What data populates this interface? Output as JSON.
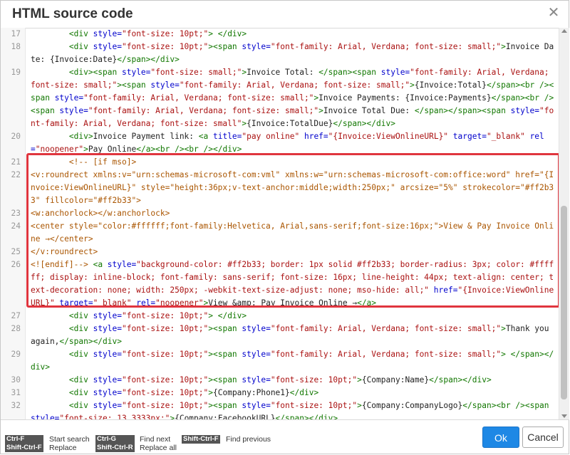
{
  "dialog": {
    "title": "HTML source code",
    "close_symbol": "✕",
    "ok_label": "Ok",
    "cancel_label": "Cancel"
  },
  "editor": {
    "lines": [
      {
        "num": "17",
        "tokens": [
          {
            "c": "x",
            "v": "        "
          },
          {
            "c": "t",
            "v": "<div "
          },
          {
            "c": "a",
            "v": "style="
          },
          {
            "c": "s",
            "v": "\"font-size: 10pt;\""
          },
          {
            "c": "t",
            "v": "> </div>"
          }
        ]
      },
      {
        "num": "18",
        "tokens": [
          {
            "c": "x",
            "v": "        "
          },
          {
            "c": "t",
            "v": "<div "
          },
          {
            "c": "a",
            "v": "style="
          },
          {
            "c": "s",
            "v": "\"font-size: 10pt;\""
          },
          {
            "c": "t",
            "v": "><span "
          },
          {
            "c": "a",
            "v": "style="
          },
          {
            "c": "s",
            "v": "\"font-family: Arial, Verdana; font-size: small;\""
          },
          {
            "c": "t",
            "v": ">"
          },
          {
            "c": "x",
            "v": "Invoice Date: {Invoice:Date}"
          },
          {
            "c": "t",
            "v": "</span></div>"
          }
        ]
      },
      {
        "num": "19",
        "tokens": [
          {
            "c": "x",
            "v": "        "
          },
          {
            "c": "t",
            "v": "<div><span "
          },
          {
            "c": "a",
            "v": "style="
          },
          {
            "c": "s",
            "v": "\"font-size: small;\""
          },
          {
            "c": "t",
            "v": ">"
          },
          {
            "c": "x",
            "v": "Invoice Total: "
          },
          {
            "c": "t",
            "v": "</span><span "
          },
          {
            "c": "a",
            "v": "style="
          },
          {
            "c": "s",
            "v": "\"font-family: Arial, Verdana; font-size: small;\""
          },
          {
            "c": "t",
            "v": "><span "
          },
          {
            "c": "a",
            "v": "style="
          },
          {
            "c": "s",
            "v": "\"font-family: Arial, Verdana; font-size: small;\""
          },
          {
            "c": "t",
            "v": ">"
          },
          {
            "c": "x",
            "v": "{Invoice:Total}"
          },
          {
            "c": "t",
            "v": "</span><br /><span "
          },
          {
            "c": "a",
            "v": "style="
          },
          {
            "c": "s",
            "v": "\"font-family: Arial, Verdana; font-size: small;\""
          },
          {
            "c": "t",
            "v": ">"
          },
          {
            "c": "x",
            "v": "Invoice Payments: {Invoice:Payments}"
          },
          {
            "c": "t",
            "v": "</span><br /><span "
          },
          {
            "c": "a",
            "v": "style="
          },
          {
            "c": "s",
            "v": "\"font-family: Arial, Verdana; font-size: small;\""
          },
          {
            "c": "t",
            "v": ">"
          },
          {
            "c": "x",
            "v": "Invoice Total Due: "
          },
          {
            "c": "t",
            "v": "</span></span><span "
          },
          {
            "c": "a",
            "v": "style="
          },
          {
            "c": "s",
            "v": "\"font-family: Arial, Verdana; font-size: small\""
          },
          {
            "c": "t",
            "v": ">"
          },
          {
            "c": "x",
            "v": "{Invoice:TotalDue}"
          },
          {
            "c": "t",
            "v": "</span></div>"
          }
        ]
      },
      {
        "num": "20",
        "tokens": [
          {
            "c": "x",
            "v": "        "
          },
          {
            "c": "t",
            "v": "<div>"
          },
          {
            "c": "x",
            "v": "Invoice Payment link: "
          },
          {
            "c": "t",
            "v": "<a "
          },
          {
            "c": "a",
            "v": "title="
          },
          {
            "c": "s",
            "v": "\"pay online\" "
          },
          {
            "c": "a",
            "v": "href="
          },
          {
            "c": "s",
            "v": "\"{Invoice:ViewOnlineURL}\" "
          },
          {
            "c": "a",
            "v": "target="
          },
          {
            "c": "s",
            "v": "\"_blank\" "
          },
          {
            "c": "a",
            "v": "rel="
          },
          {
            "c": "s",
            "v": "\"noopener\""
          },
          {
            "c": "t",
            "v": ">"
          },
          {
            "c": "x",
            "v": "Pay Online"
          },
          {
            "c": "t",
            "v": "</a><br /><br /></div>"
          }
        ]
      },
      {
        "num": "21",
        "tokens": [
          {
            "c": "x",
            "v": "        "
          },
          {
            "c": "c",
            "v": "<!-- [if mso]>"
          }
        ]
      },
      {
        "num": "22",
        "tokens": [
          {
            "c": "c",
            "v": "<v:roundrect xmlns:v=\"urn:schemas-microsoft-com:vml\" xmlns:w=\"urn:schemas-microsoft-com:office:word\" href=\"{Invoice:ViewOnlineURL}\" style=\"height:36px;v-text-anchor:middle;width:250px;\" arcsize=\"5%\" strokecolor=\"#ff2b33\" fillcolor=\"#ff2b33\">"
          }
        ]
      },
      {
        "num": "23",
        "tokens": [
          {
            "c": "c",
            "v": "<w:anchorlock></w:anchorlock>"
          }
        ]
      },
      {
        "num": "24",
        "tokens": [
          {
            "c": "c",
            "v": "<center style=\"color:#ffffff;font-family:Helvetica, Arial,sans-serif;font-size:16px;\">View & Pay Invoice Online →</center>"
          }
        ]
      },
      {
        "num": "25",
        "tokens": [
          {
            "c": "c",
            "v": "</v:roundrect>"
          }
        ]
      },
      {
        "num": "26",
        "tokens": [
          {
            "c": "c",
            "v": "<![endif]-->"
          },
          {
            "c": "x",
            "v": " "
          },
          {
            "c": "t",
            "v": "<a "
          },
          {
            "c": "a",
            "v": "style="
          },
          {
            "c": "s",
            "v": "\"background-color: #ff2b33; border: 1px solid #ff2b33; border-radius: 3px; color: #ffffff; display: inline-block; font-family: sans-serif; font-size: 16px; line-height: 44px; text-align: center; text-decoration: none; width: 250px; -webkit-text-size-adjust: none; mso-hide: all;\" "
          },
          {
            "c": "a",
            "v": "href="
          },
          {
            "c": "s",
            "v": "\"{Invoice:ViewOnlineURL}\" "
          },
          {
            "c": "a",
            "v": "target="
          },
          {
            "c": "s",
            "v": "\"_blank\" "
          },
          {
            "c": "a",
            "v": "rel="
          },
          {
            "c": "s",
            "v": "\"noopener\""
          },
          {
            "c": "t",
            "v": ">"
          },
          {
            "c": "x",
            "v": "View &amp; Pay Invoice Online →"
          },
          {
            "c": "t",
            "v": "</a>"
          }
        ]
      },
      {
        "num": "27",
        "tokens": [
          {
            "c": "x",
            "v": "        "
          },
          {
            "c": "t",
            "v": "<div "
          },
          {
            "c": "a",
            "v": "style="
          },
          {
            "c": "s",
            "v": "\"font-size: 10pt;\""
          },
          {
            "c": "t",
            "v": "> </div>"
          }
        ]
      },
      {
        "num": "28",
        "tokens": [
          {
            "c": "x",
            "v": "        "
          },
          {
            "c": "t",
            "v": "<div "
          },
          {
            "c": "a",
            "v": "style="
          },
          {
            "c": "s",
            "v": "\"font-size: 10pt;\""
          },
          {
            "c": "t",
            "v": "><span "
          },
          {
            "c": "a",
            "v": "style="
          },
          {
            "c": "s",
            "v": "\"font-family: Arial, Verdana; font-size: small;\""
          },
          {
            "c": "t",
            "v": ">"
          },
          {
            "c": "x",
            "v": "Thank you again,"
          },
          {
            "c": "t",
            "v": "</span></div>"
          }
        ]
      },
      {
        "num": "29",
        "tokens": [
          {
            "c": "x",
            "v": "        "
          },
          {
            "c": "t",
            "v": "<div "
          },
          {
            "c": "a",
            "v": "style="
          },
          {
            "c": "s",
            "v": "\"font-size: 10pt;\""
          },
          {
            "c": "t",
            "v": "><span "
          },
          {
            "c": "a",
            "v": "style="
          },
          {
            "c": "s",
            "v": "\"font-family: Arial, Verdana; font-size: small;\""
          },
          {
            "c": "t",
            "v": "> </span></div>"
          }
        ]
      },
      {
        "num": "30",
        "tokens": [
          {
            "c": "x",
            "v": "        "
          },
          {
            "c": "t",
            "v": "<div "
          },
          {
            "c": "a",
            "v": "style="
          },
          {
            "c": "s",
            "v": "\"font-size: 10pt;\""
          },
          {
            "c": "t",
            "v": "><span "
          },
          {
            "c": "a",
            "v": "style="
          },
          {
            "c": "s",
            "v": "\"font-size: 10pt;\""
          },
          {
            "c": "t",
            "v": ">"
          },
          {
            "c": "x",
            "v": "{Company:Name}"
          },
          {
            "c": "t",
            "v": "</span></div>"
          }
        ]
      },
      {
        "num": "31",
        "tokens": [
          {
            "c": "x",
            "v": "        "
          },
          {
            "c": "t",
            "v": "<div "
          },
          {
            "c": "a",
            "v": "style="
          },
          {
            "c": "s",
            "v": "\"font-size: 10pt;\""
          },
          {
            "c": "t",
            "v": ">"
          },
          {
            "c": "x",
            "v": "{Company:Phone1}"
          },
          {
            "c": "t",
            "v": "</div>"
          }
        ]
      },
      {
        "num": "32",
        "tokens": [
          {
            "c": "x",
            "v": "        "
          },
          {
            "c": "t",
            "v": "<div "
          },
          {
            "c": "a",
            "v": "style="
          },
          {
            "c": "s",
            "v": "\"font-size: 10pt;\""
          },
          {
            "c": "t",
            "v": "><span "
          },
          {
            "c": "a",
            "v": "style="
          },
          {
            "c": "s",
            "v": "\"font-size: 10pt;\""
          },
          {
            "c": "t",
            "v": ">"
          },
          {
            "c": "x",
            "v": "{Company:CompanyLogo}"
          },
          {
            "c": "t",
            "v": "</span><br /><span "
          },
          {
            "c": "a",
            "v": "style="
          },
          {
            "c": "s",
            "v": "\"font-size: 13.3333px;\""
          },
          {
            "c": "t",
            "v": ">"
          },
          {
            "c": "x",
            "v": "{Company:FacebookURL}"
          },
          {
            "c": "t",
            "v": "</span></div>"
          }
        ]
      }
    ]
  },
  "shortcuts": [
    {
      "key1": "Ctrl-F",
      "key2": "Shift-Ctrl-F",
      "label1": "Start search",
      "label2": "Replace"
    },
    {
      "key1": "Ctrl-G",
      "key2": "Shift-Ctrl-R",
      "label1": "Find next",
      "label2": "Replace all"
    },
    {
      "key1": "Shift-Ctrl-F",
      "key2": "",
      "label1": "Find previous",
      "label2": ""
    }
  ],
  "colors": {
    "tag": "#117700",
    "attribute": "#0000cc",
    "string": "#aa1111",
    "comment": "#aa5500",
    "highlight_border": "#e0353e",
    "ok_button": "#1e88e5"
  }
}
